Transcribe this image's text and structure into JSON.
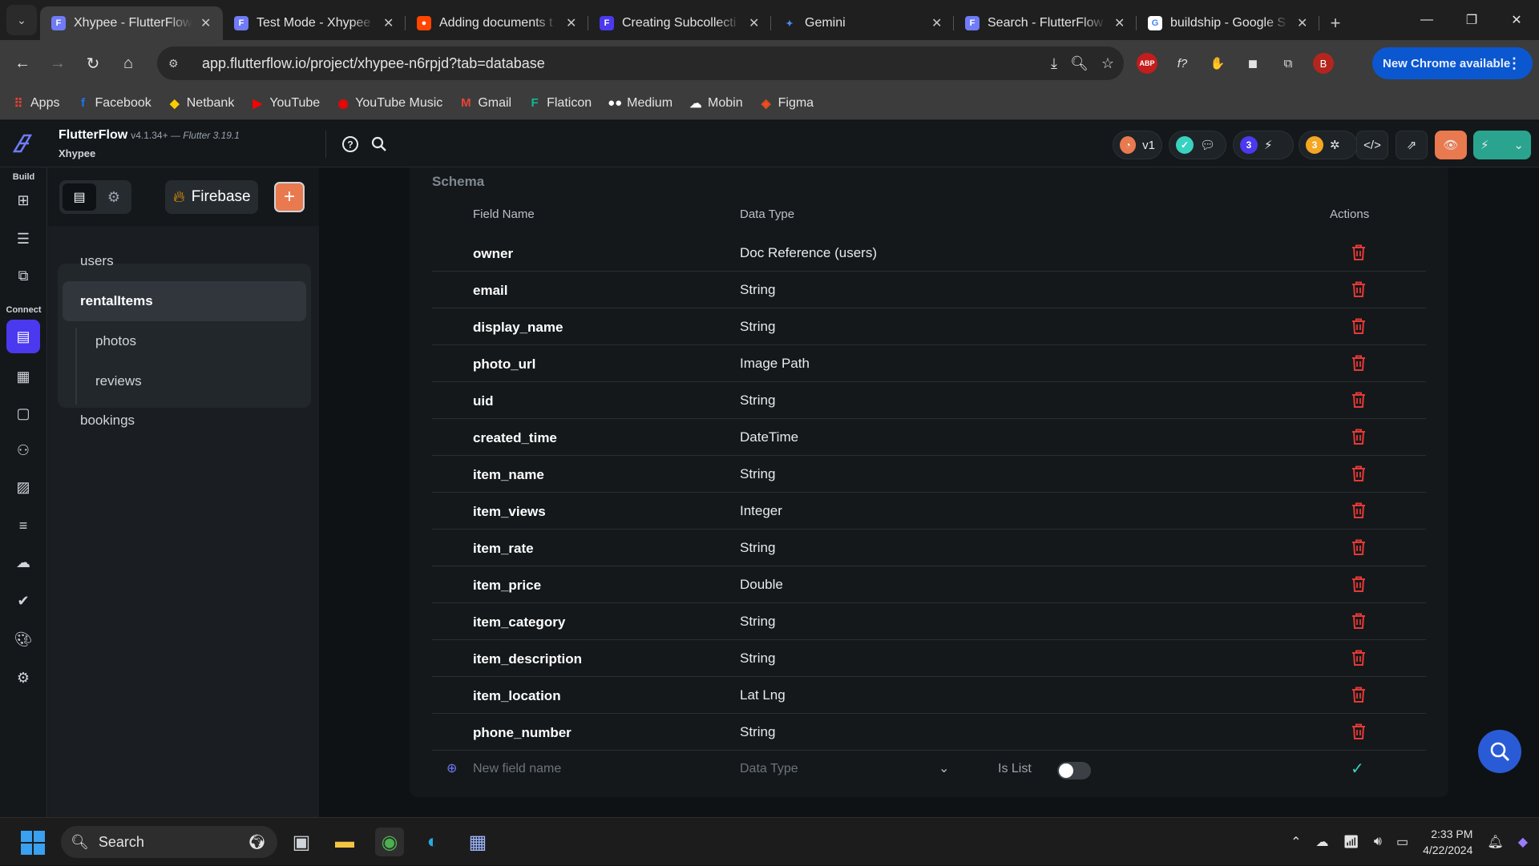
{
  "browser": {
    "tabs": [
      {
        "title": "Xhypee - FlutterFlow",
        "active": true,
        "favicon": "flutterflow-icon",
        "color": "#6f7bf7"
      },
      {
        "title": "Test Mode - Xhypee",
        "active": false,
        "favicon": "flutterflow-icon",
        "color": "#6f7bf7"
      },
      {
        "title": "Adding documents t",
        "active": false,
        "favicon": "reddit-icon",
        "color": "#ff4500"
      },
      {
        "title": "Creating Subcollecti",
        "active": false,
        "favicon": "flutterflow-icon",
        "color": "#4b39ef"
      },
      {
        "title": "Gemini",
        "active": false,
        "favicon": "gemini-icon",
        "color": "#4b8cf7"
      },
      {
        "title": "Search - FlutterFlow",
        "active": false,
        "favicon": "flutterflow-icon",
        "color": "#6f7bf7"
      },
      {
        "title": "buildship - Google S",
        "active": false,
        "favicon": "google-icon",
        "color": "#ffffff"
      }
    ],
    "url": "app.flutterflow.io/project/xhypee-n6rpjd?tab=database",
    "new_chrome_label": "New Chrome available",
    "profile_initial": "B",
    "bookmarks": [
      {
        "label": "Apps",
        "icon": "apps-grid-icon",
        "color": "#e94235"
      },
      {
        "label": "Facebook",
        "icon": "facebook-icon",
        "color": "#1877f2"
      },
      {
        "label": "Netbank",
        "icon": "netbank-icon",
        "color": "#ffcc00"
      },
      {
        "label": "YouTube",
        "icon": "youtube-icon",
        "color": "#ff0000"
      },
      {
        "label": "YouTube Music",
        "icon": "youtube-music-icon",
        "color": "#ff0000"
      },
      {
        "label": "Gmail",
        "icon": "gmail-icon",
        "color": "#ea4335"
      },
      {
        "label": "Flaticon",
        "icon": "flaticon-icon",
        "color": "#0fb993"
      },
      {
        "label": "Medium",
        "icon": "medium-icon",
        "color": "#ffffff"
      },
      {
        "label": "Mobin",
        "icon": "mobin-icon",
        "color": "#ffffff"
      },
      {
        "label": "Figma",
        "icon": "figma-icon",
        "color": "#f24e1e"
      }
    ]
  },
  "app": {
    "brand_name": "FlutterFlow",
    "version": "v4.1.34+",
    "flutter_version": "— Flutter 3.19.1",
    "project_name": "Xhypee",
    "version_pill": "v1",
    "badge_count_purple": "3",
    "badge_count_orange": "3",
    "rail_labels": {
      "build": "Build",
      "connect": "Connect"
    },
    "firebase_label": "Firebase",
    "accent_color": "#4b39ef",
    "collections": [
      {
        "name": "users",
        "level": 0,
        "selected": false
      },
      {
        "name": "rentalItems",
        "level": 0,
        "selected": true
      },
      {
        "name": "photos",
        "level": 1,
        "selected": false
      },
      {
        "name": "reviews",
        "level": 1,
        "selected": false
      },
      {
        "name": "bookings",
        "level": 0,
        "selected": false
      }
    ],
    "schema": {
      "heading": "Schema",
      "columns": {
        "field_name": "Field Name",
        "data_type": "Data Type",
        "actions": "Actions"
      },
      "fields": [
        {
          "name": "owner",
          "type": "Doc Reference (users)"
        },
        {
          "name": "email",
          "type": "String"
        },
        {
          "name": "display_name",
          "type": "String"
        },
        {
          "name": "photo_url",
          "type": "Image Path"
        },
        {
          "name": "uid",
          "type": "String"
        },
        {
          "name": "created_time",
          "type": "DateTime"
        },
        {
          "name": "item_name",
          "type": "String"
        },
        {
          "name": "item_views",
          "type": "Integer"
        },
        {
          "name": "item_rate",
          "type": "String"
        },
        {
          "name": "item_price",
          "type": "Double"
        },
        {
          "name": "item_category",
          "type": "String"
        },
        {
          "name": "item_description",
          "type": "String"
        },
        {
          "name": "item_location",
          "type": "Lat Lng"
        },
        {
          "name": "phone_number",
          "type": "String"
        }
      ],
      "new_field": {
        "placeholder": "New field name",
        "type_placeholder": "Data Type",
        "is_list_label": "Is List"
      },
      "delete_color": "#e53935"
    }
  },
  "taskbar": {
    "search_label": "Search",
    "time": "2:33 PM",
    "date": "4/22/2024"
  }
}
